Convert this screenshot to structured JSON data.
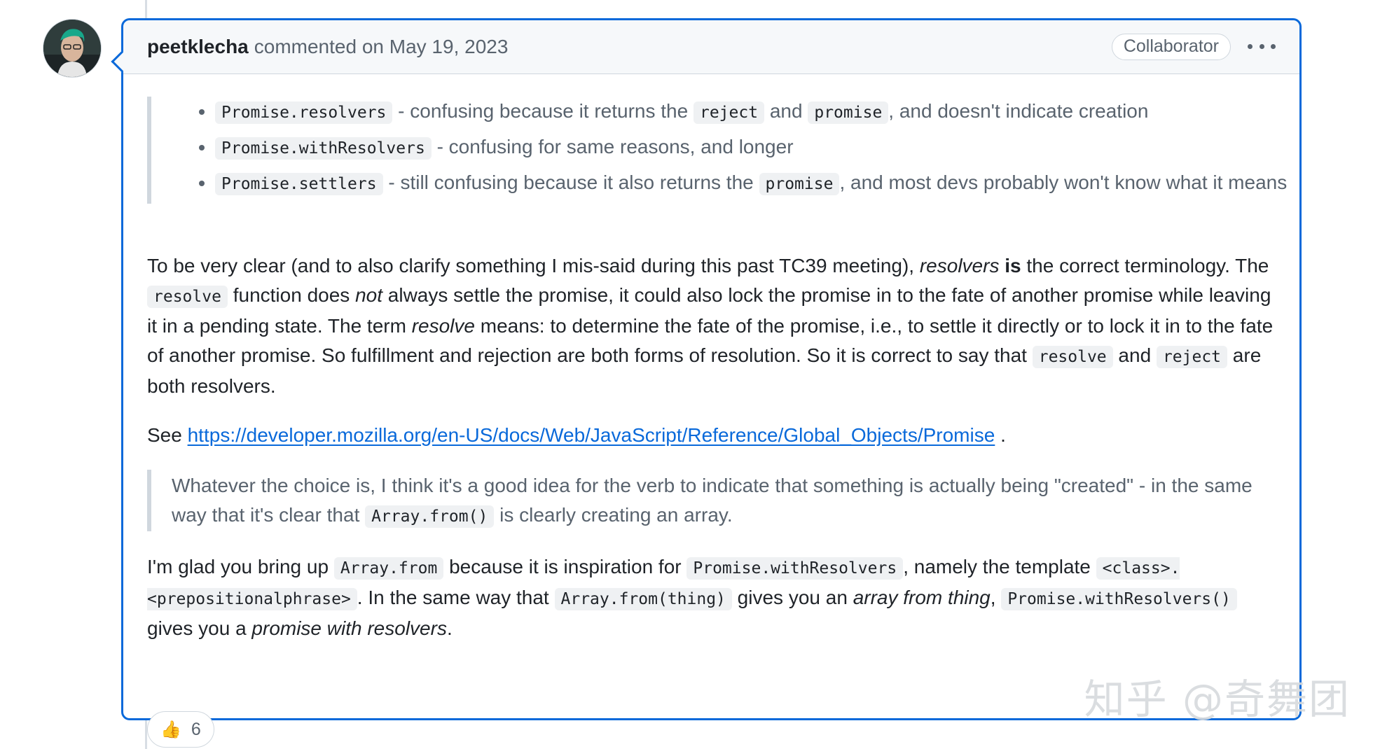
{
  "comment": {
    "author": "peetklecha",
    "action_text": "commented on May 19, 2023",
    "role_badge": "Collaborator",
    "more_menu_icon": "kebab-horizontal-icon"
  },
  "quote1": {
    "items": [
      {
        "code1": "Promise.resolvers",
        "t1": " - confusing because it returns the ",
        "code2": "reject",
        "t2": " and ",
        "code3": "promise",
        "t3": ", and doesn't indicate creation"
      },
      {
        "code1": "Promise.withResolvers",
        "t1": " - confusing for same reasons, and longer"
      },
      {
        "code1": "Promise.settlers",
        "t1": " - still confusing because it also returns the ",
        "code2": "promise",
        "t2": ", and most devs probably won't know what it means"
      }
    ]
  },
  "para1": {
    "t1": "To be very clear (and to also clarify something I mis-said during this past TC39 meeting), ",
    "em1": "resolvers",
    "strong1": " is",
    "t2": " the correct terminology. The ",
    "code1": "resolve",
    "t3": " function does ",
    "em2": "not",
    "t4": " always settle the promise, it could also lock the promise in to the fate of another promise while leaving it in a pending state. The term ",
    "em3": "resolve",
    "t5": " means: to determine the fate of the promise, i.e., to settle it directly or to lock it in to the fate of another promise. So fulfillment and rejection are both forms of resolution. So it is correct to say that ",
    "code2": "resolve",
    "t6": " and ",
    "code3": "reject",
    "t7": " are both resolvers."
  },
  "para2": {
    "prefix": "See ",
    "link": "https://developer.mozilla.org/en-US/docs/Web/JavaScript/Reference/Global_Objects/Promise",
    "suffix": " ."
  },
  "quote2": {
    "t1": "Whatever the choice is, I think it's a good idea for the verb to indicate that something is actually being \"created\" - in the same way that it's clear that ",
    "code1": "Array.from()",
    "t2": " is clearly creating an array."
  },
  "para3": {
    "t1": "I'm glad you bring up ",
    "code1": "Array.from",
    "t2": " because it is inspiration for ",
    "code2": "Promise.withResolvers",
    "t3": ", namely the template ",
    "code3": "<class>.<prepositionalphrase>",
    "t4": ". In the same way that ",
    "code4": "Array.from(thing)",
    "t5": " gives you an ",
    "em1": "array from thing",
    "t6": ", ",
    "code5": "Promise.withResolvers()",
    "t7": " gives you a ",
    "em2": "promise with resolvers",
    "t8": "."
  },
  "reactions": {
    "emoji": "👍",
    "count": "6"
  },
  "watermark": "知乎 @奇舞团"
}
